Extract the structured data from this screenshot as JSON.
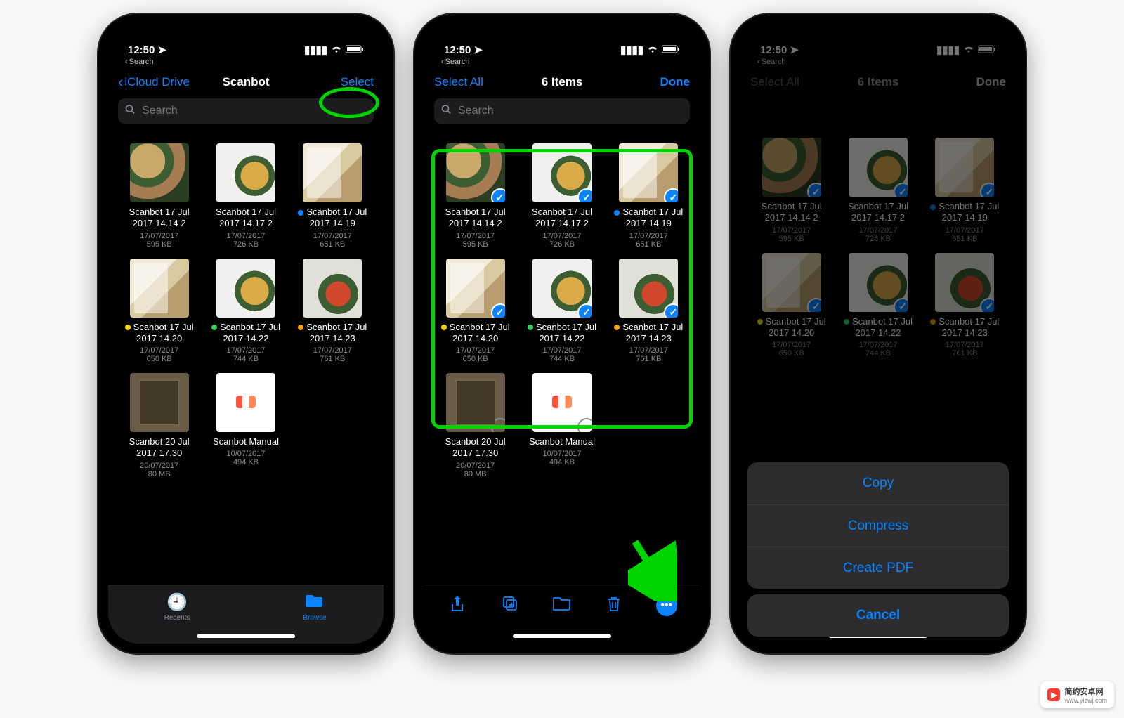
{
  "status": {
    "time": "12:50",
    "back_label": "Search"
  },
  "screen1": {
    "nav_back": "iCloud Drive",
    "nav_title": "Scanbot",
    "nav_action": "Select",
    "search_placeholder": "Search",
    "tabs": {
      "recents": "Recents",
      "browse": "Browse"
    }
  },
  "screen2": {
    "nav_left": "Select All",
    "nav_title": "6 Items",
    "nav_right": "Done",
    "search_placeholder": "Search"
  },
  "screen3": {
    "nav_left": "Select All",
    "nav_title": "6 Items",
    "nav_right": "Done",
    "actions": {
      "copy": "Copy",
      "compress": "Compress",
      "create_pdf": "Create PDF",
      "cancel": "Cancel"
    }
  },
  "files": [
    {
      "name": "Scanbot 17 Jul 2017 14.14 2",
      "date": "17/07/2017",
      "size": "595 KB",
      "tag": null,
      "thumb": "food1"
    },
    {
      "name": "Scanbot 17 Jul 2017 14.17 2",
      "date": "17/07/2017",
      "size": "726 KB",
      "tag": null,
      "thumb": "food2"
    },
    {
      "name": "Scanbot 17 Jul 2017 14.19",
      "date": "17/07/2017",
      "size": "651 KB",
      "tag": "blue",
      "thumb": "scan"
    },
    {
      "name": "Scanbot 17 Jul 2017 14.20",
      "date": "17/07/2017",
      "size": "650 KB",
      "tag": "yellow",
      "thumb": "scan"
    },
    {
      "name": "Scanbot 17 Jul 2017 14.22",
      "date": "17/07/2017",
      "size": "744 KB",
      "tag": "green",
      "thumb": "food2"
    },
    {
      "name": "Scanbot 17 Jul 2017 14.23",
      "date": "17/07/2017",
      "size": "761 KB",
      "tag": "orange",
      "thumb": "food3"
    }
  ],
  "extras": [
    {
      "name": "Scanbot 20 Jul 2017 17.30",
      "date": "20/07/2017",
      "size": "80 MB",
      "thumb": "book"
    },
    {
      "name": "Scanbot Manual",
      "date": "10/07/2017",
      "size": "494 KB",
      "thumb": "doc"
    }
  ],
  "watermark": {
    "title": "简约安卓网",
    "url": "www.yizwj.com"
  }
}
